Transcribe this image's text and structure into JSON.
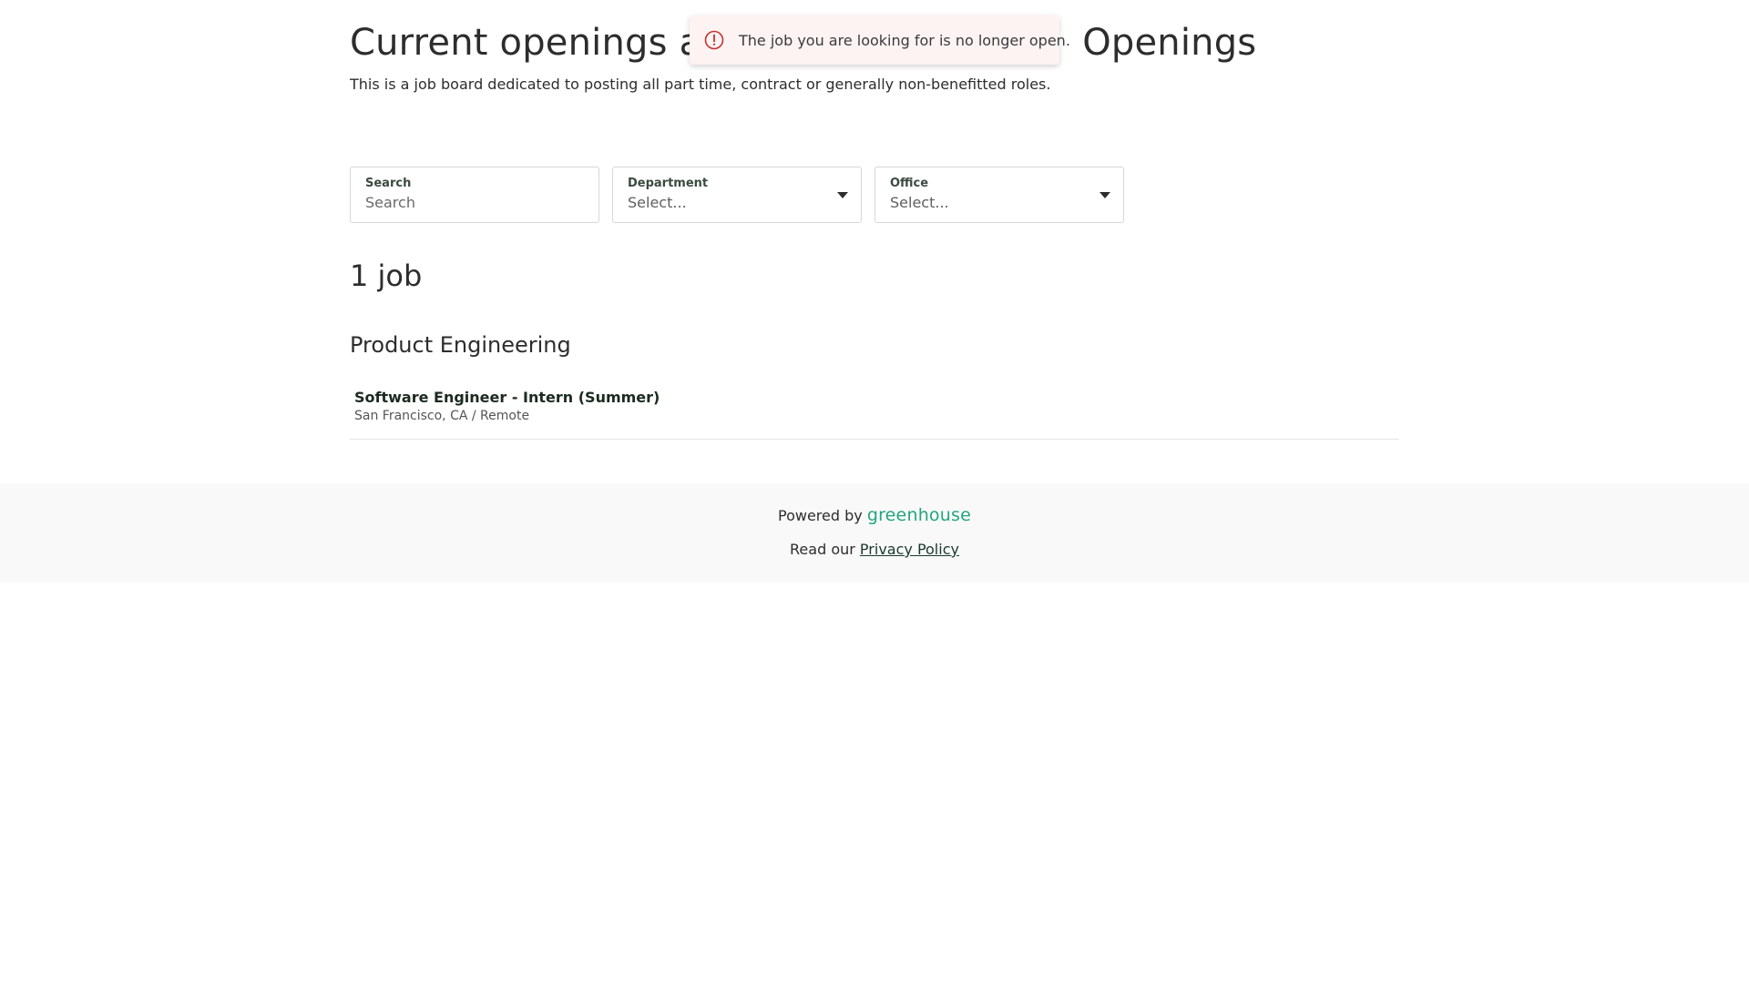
{
  "header": {
    "title_visible_left": "Current openings at",
    "title_visible_right": "Openings",
    "description": "This is a job board dedicated to posting all part time, contract or generally non-benefitted roles."
  },
  "toast": {
    "message": "The job you are looking for is no longer open.",
    "icon": "alert-circle-icon",
    "color": "#c53030"
  },
  "filters": {
    "search": {
      "label": "Search",
      "placeholder": "Search"
    },
    "department": {
      "label": "Department",
      "value": "Select..."
    },
    "office": {
      "label": "Office",
      "value": "Select..."
    }
  },
  "results": {
    "count_label": "1 job",
    "departments": [
      {
        "name": "Product Engineering",
        "jobs": [
          {
            "title": "Software Engineer - Intern (Summer)",
            "location": "San Francisco, CA / Remote"
          }
        ]
      }
    ]
  },
  "footer": {
    "powered_by": "Powered by",
    "brand": "greenhouse",
    "brand_color": "#24a47f",
    "read_our": "Read our",
    "privacy_link": "Privacy Policy"
  }
}
